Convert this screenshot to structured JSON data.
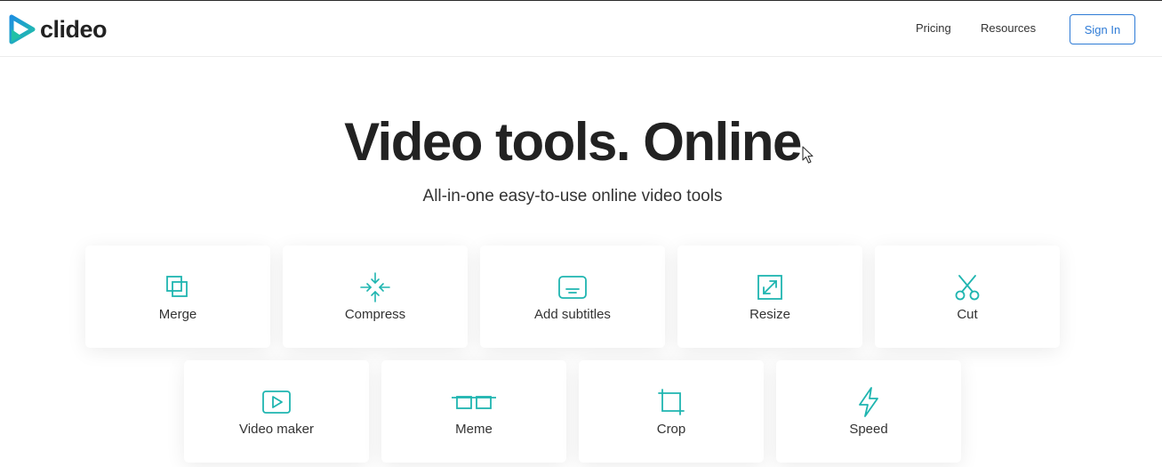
{
  "brand": {
    "name": "clideo",
    "accent": "#2e7bd6",
    "icon_color": "#1fb5b0"
  },
  "nav": {
    "pricing": "Pricing",
    "resources": "Resources",
    "signin": "Sign In"
  },
  "hero": {
    "title": "Video tools. Online",
    "subtitle": "All-in-one easy-to-use online video tools"
  },
  "tools": [
    {
      "label": "Merge",
      "icon": "merge-icon"
    },
    {
      "label": "Compress",
      "icon": "compress-icon"
    },
    {
      "label": "Add subtitles",
      "icon": "subtitles-icon"
    },
    {
      "label": "Resize",
      "icon": "resize-icon"
    },
    {
      "label": "Cut",
      "icon": "scissors-icon"
    },
    {
      "label": "Video maker",
      "icon": "play-icon"
    },
    {
      "label": "Meme",
      "icon": "meme-glasses-icon"
    },
    {
      "label": "Crop",
      "icon": "crop-icon"
    },
    {
      "label": "Speed",
      "icon": "lightning-icon"
    }
  ]
}
